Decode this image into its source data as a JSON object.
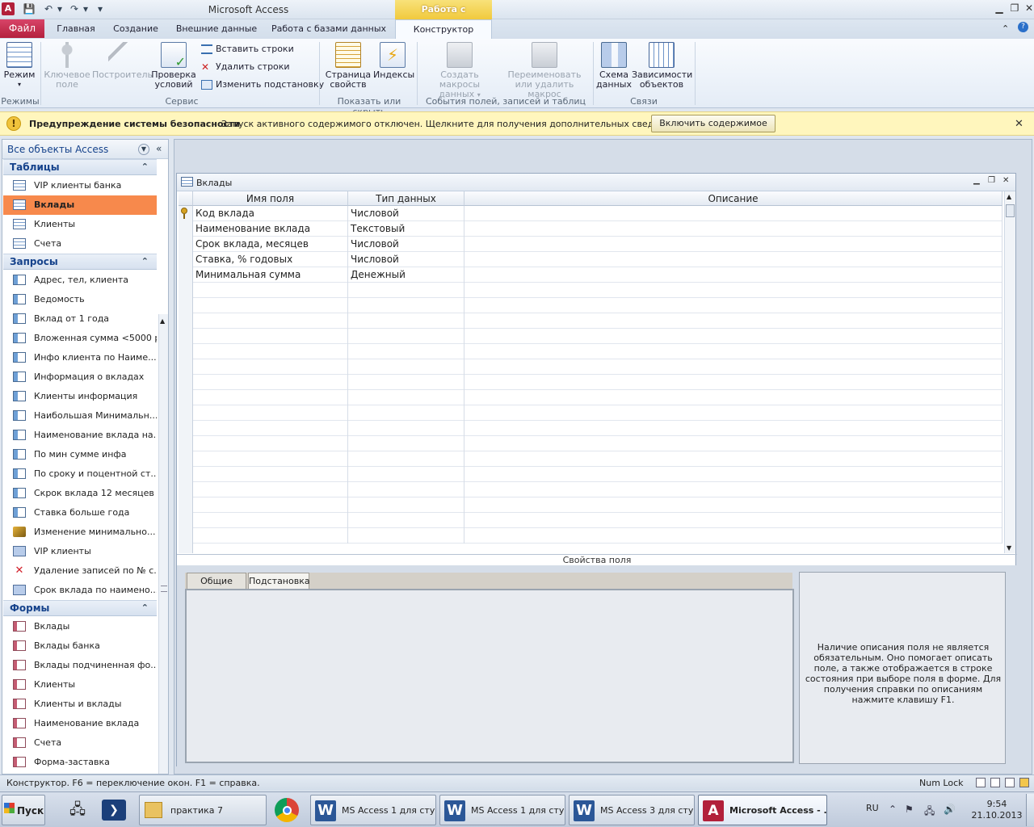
{
  "titlebar": {
    "app_title": "Microsoft Access",
    "context_group": "Работа с таблицами",
    "app_icon": "A"
  },
  "tabs": {
    "file": "Файл",
    "home": "Главная",
    "create": "Создание",
    "external": "Внешние данные",
    "database": "Работа с базами данных",
    "constructor": "Конструктор"
  },
  "ribbon": {
    "view": "Режим",
    "key_field_1": "Ключевое",
    "key_field_2": "поле",
    "builder": "Построитель",
    "check_1": "Проверка",
    "check_2": "условий",
    "insert_rows": "Вставить строки",
    "delete_rows": "Удалить строки",
    "modify_lookup": "Изменить подстановку",
    "prop_sheet_1": "Страница",
    "prop_sheet_2": "свойств",
    "indexes": "Индексы",
    "create_macros_1": "Создать макросы",
    "create_macros_2": "данных",
    "rename_macro_1": "Переименовать",
    "rename_macro_2": "или удалить макрос",
    "schema_1": "Схема",
    "schema_2": "данных",
    "deps_1": "Зависимости",
    "deps_2": "объектов",
    "group_modes": "Режимы",
    "group_service": "Сервис",
    "group_showhide": "Показать или скрыть",
    "group_events": "События полей, записей и таблиц",
    "group_relations": "Связи"
  },
  "security": {
    "title": "Предупреждение системы безопасности",
    "message": "Запуск активного содержимого отключен. Щелкните для получения дополнительных сведений.",
    "enable_button": "Включить содержимое"
  },
  "nav": {
    "title": "Все объекты Access",
    "sections": [
      {
        "label": "Таблицы",
        "items": [
          "VIP клиенты банка",
          "Вклады",
          "Клиенты",
          "Счета"
        ]
      },
      {
        "label": "Запросы",
        "items": [
          "Адрес, тел, клиента",
          "Ведомость",
          "Вклад от 1 года",
          "Вложенная сумма <5000 р",
          "Инфо клиента по Наиме...",
          "Информация о вкладах",
          "Клиенты информация",
          "Наибольшая Минимальн...",
          "Наименование вклада на...",
          "По мин сумме инфа",
          "По сроку и поцентной ст...",
          "Скрок вклада 12 месяцев",
          "Ставка больше года",
          "Изменение минимально...",
          "VIP клиенты",
          "Удаление записей по № с...",
          "Срок вклада по наимено..."
        ]
      },
      {
        "label": "Формы",
        "items": [
          "Вклады",
          "Вклады банка",
          "Вклады подчиненная фо...",
          "Клиенты",
          "Клиенты и вклады",
          "Наименование вклада",
          "Счета",
          "Форма-заставка"
        ]
      }
    ]
  },
  "document": {
    "title": "Вклады",
    "columns": [
      "Имя поля",
      "Тип данных",
      "Описание"
    ],
    "rows": [
      {
        "name": "Код вклада",
        "type": "Числовой",
        "desc": ""
      },
      {
        "name": "Наименование вклада",
        "type": "Текстовый",
        "desc": ""
      },
      {
        "name": "Срок вклада, месяцев",
        "type": "Числовой",
        "desc": ""
      },
      {
        "name": "Ставка, % годовых",
        "type": "Числовой",
        "desc": ""
      },
      {
        "name": "Минимальная сумма",
        "type": "Денежный",
        "desc": ""
      }
    ],
    "props_label": "Свойства поля",
    "tab_general": "Общие",
    "tab_lookup": "Подстановка",
    "help_text": "Наличие описания поля не является обязательным. Оно помогает описать поле, а также отображается в строке состояния при выборе поля в форме. Для получения справки по описаниям нажмите клавишу F1."
  },
  "status": {
    "text": "Конструктор.  F6 = переключение окон.  F1 = справка.",
    "numlock": "Num Lock"
  },
  "taskbar": {
    "start": "Пуск",
    "tasks": [
      "практика 7",
      "MS Access 1 для сту...",
      "MS Access 1 для сту...",
      "MS Access 3 для сту...",
      "Microsoft Access - ..."
    ],
    "lang": "RU",
    "time": "9:54",
    "date": "21.10.2013"
  }
}
